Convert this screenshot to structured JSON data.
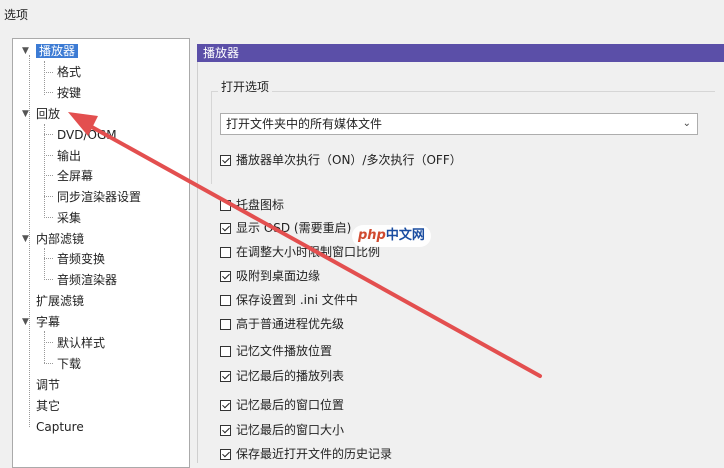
{
  "window": {
    "title": "选项"
  },
  "tree": {
    "items": [
      {
        "label": "播放器",
        "expanded": true,
        "selected": true
      },
      {
        "label": "格式"
      },
      {
        "label": "按键"
      },
      {
        "label": "回放",
        "expanded": true
      },
      {
        "label": "DVD/OGM"
      },
      {
        "label": "输出"
      },
      {
        "label": "全屏幕"
      },
      {
        "label": "同步渲染器设置"
      },
      {
        "label": "采集"
      },
      {
        "label": "内部滤镜",
        "expanded": true
      },
      {
        "label": "音频变换"
      },
      {
        "label": "音频渲染器"
      },
      {
        "label": "扩展滤镜"
      },
      {
        "label": "字幕",
        "expanded": true
      },
      {
        "label": "默认样式"
      },
      {
        "label": "下载"
      },
      {
        "label": "调节"
      },
      {
        "label": "其它"
      },
      {
        "label": "Capture"
      }
    ]
  },
  "panel": {
    "header": "播放器",
    "open_group_title": "打开选项",
    "open_dropdown_value": "打开文件夹中的所有媒体文件",
    "single_instance_label": "播放器单次执行（ON）/多次执行（OFF）",
    "options": [
      {
        "label": "托盘图标",
        "checked": false
      },
      {
        "label": "显示 OSD (需要重启)",
        "checked": true
      },
      {
        "label": "在调整大小时限制窗口比例",
        "checked": false
      },
      {
        "label": "吸附到桌面边缘",
        "checked": true
      },
      {
        "label": "保存设置到 .ini 文件中",
        "checked": false
      },
      {
        "label": "高于普通进程优先级",
        "checked": false
      },
      {
        "label": "记忆文件播放位置",
        "checked": false
      },
      {
        "label": "记忆最后的播放列表",
        "checked": true
      },
      {
        "label": "记忆最后的窗口位置",
        "checked": true
      },
      {
        "label": "记忆最后的窗口大小",
        "checked": true
      },
      {
        "label": "保存最近打开文件的历史记录",
        "checked": true
      }
    ]
  },
  "watermark": {
    "php": "php",
    "cn": "中文网"
  },
  "colors": {
    "header_bg": "#5b4fa8",
    "selection": "#3c7bd4",
    "arrow": "#e34f4f"
  }
}
